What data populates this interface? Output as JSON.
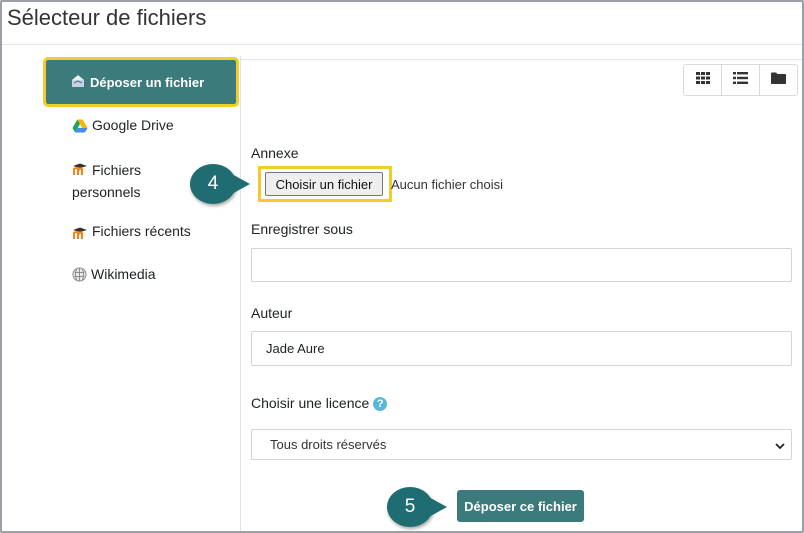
{
  "window": {
    "title": "Sélecteur de fichiers"
  },
  "sidebar": {
    "items": [
      {
        "label": "Déposer un fichier",
        "icon": "upload-icon",
        "active": true
      },
      {
        "label": "Google Drive",
        "icon": "google-drive-icon"
      },
      {
        "label_line1": "Fichiers",
        "label_line2": "personnels",
        "icon": "moodle-icon"
      },
      {
        "label": "Fichiers récents",
        "icon": "moodle-icon"
      },
      {
        "label": "Wikimedia",
        "icon": "wikimedia-icon"
      }
    ]
  },
  "viewbar": {
    "buttons": [
      {
        "icon": "grid-icon"
      },
      {
        "icon": "list-icon"
      },
      {
        "icon": "folder-icon"
      }
    ]
  },
  "form": {
    "attachment_label": "Annexe",
    "choose_file_label": "Choisir un fichier",
    "no_file_text": "Aucun fichier choisi",
    "save_as_label": "Enregistrer sous",
    "save_as_value": "",
    "author_label": "Auteur",
    "author_value": "Jade Aure",
    "license_label": "Choisir une licence",
    "license_selected": "Tous droits réservés",
    "submit_label": "Déposer ce fichier"
  },
  "callouts": {
    "step_4": "4",
    "step_5": "5"
  },
  "colors": {
    "accent": "#3c7b7b",
    "highlight": "#f3cc2b",
    "callout": "#1f6d72",
    "help": "#5bb7d8"
  }
}
